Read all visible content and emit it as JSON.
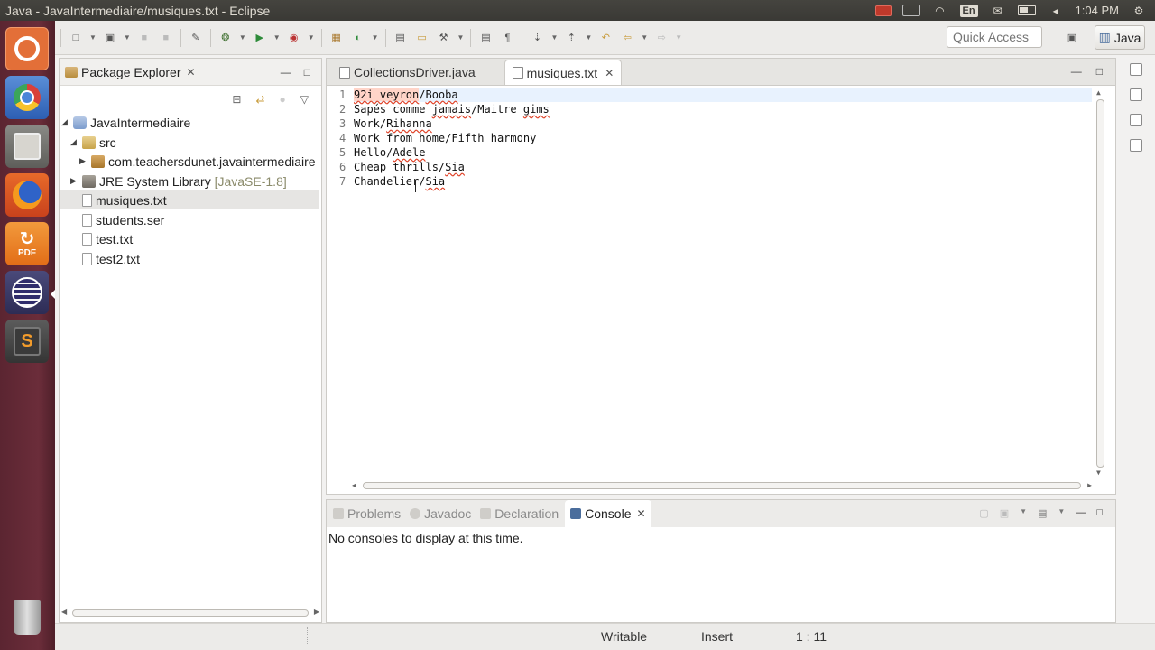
{
  "window": {
    "title": "Java - JavaIntermediaire/musiques.txt - Eclipse"
  },
  "system_tray": {
    "keyboard_layout": "En",
    "time": "1:04 PM"
  },
  "launcher": {
    "items": [
      {
        "name": "Ubuntu Dash",
        "icon": "ubuntu-icon"
      },
      {
        "name": "Chromium",
        "icon": "chrome-icon"
      },
      {
        "name": "Files",
        "icon": "files-icon"
      },
      {
        "name": "Firefox",
        "icon": "firefox-icon"
      },
      {
        "name": "PDF",
        "label": "PDF",
        "icon": "pdf-icon"
      },
      {
        "name": "Eclipse",
        "icon": "eclipse-icon"
      },
      {
        "name": "Sublime Text",
        "label": "S",
        "icon": "sublime-icon"
      },
      {
        "name": "Trash",
        "icon": "trash-icon"
      }
    ]
  },
  "toolbar": {
    "quick_access_placeholder": "Quick Access",
    "perspective": "Java"
  },
  "package_explorer": {
    "title": "Package Explorer",
    "tree": [
      {
        "label": "JavaIntermediaire",
        "type": "project",
        "expanded": true
      },
      {
        "label": "src",
        "type": "source-folder",
        "expanded": true
      },
      {
        "label": "com.teachersdunet.javaintermediaire",
        "type": "package",
        "expanded": false
      },
      {
        "label": "JRE System Library",
        "decoration": "[JavaSE-1.8]",
        "type": "library",
        "expanded": false
      },
      {
        "label": "musiques.txt",
        "type": "file",
        "selected": true
      },
      {
        "label": "students.ser",
        "type": "file"
      },
      {
        "label": "test.txt",
        "type": "file"
      },
      {
        "label": "test2.txt",
        "type": "file"
      }
    ]
  },
  "editor": {
    "tabs": [
      {
        "label": "CollectionsDriver.java",
        "active": false
      },
      {
        "label": "musiques.txt",
        "active": true
      }
    ],
    "lines": [
      {
        "num": "1",
        "selected": "92i veyron",
        "rest": "/",
        "tail_spell": "Booba"
      },
      {
        "num": "2",
        "text_a": "Sapés comme ",
        "spell_a": "jamais",
        "text_b": "/Maitre ",
        "spell_b": "gims"
      },
      {
        "num": "3",
        "text": "Work/",
        "spell": "Rihanna"
      },
      {
        "num": "4",
        "text": "Work from home/Fifth harmony"
      },
      {
        "num": "5",
        "text": "Hello/",
        "spell": "Adele"
      },
      {
        "num": "6",
        "text": "Cheap thrills/",
        "spell": "Sia"
      },
      {
        "num": "7",
        "text": "Chandelier/",
        "spell": "Sia"
      }
    ]
  },
  "bottom_panel": {
    "tabs": [
      {
        "label": "Problems",
        "active": false
      },
      {
        "label": "Javadoc",
        "active": false
      },
      {
        "label": "Declaration",
        "active": false
      },
      {
        "label": "Console",
        "active": true
      }
    ],
    "message": "No consoles to display at this time."
  },
  "status_bar": {
    "mode": "Writable",
    "insert": "Insert",
    "position": "1 : 11"
  }
}
